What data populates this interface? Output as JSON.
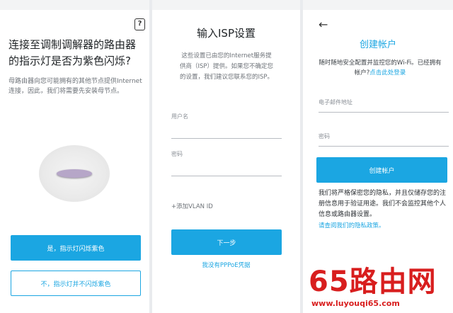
{
  "colors": {
    "accent": "#1ba6e2",
    "background": "#ffffff",
    "watermark": "#d81e1e"
  },
  "screen1": {
    "help_icon": "?",
    "title": "连接至调制调解器的路由器的指示灯是否为紫色闪烁?",
    "description": "母路由器向您可能拥有的其他节点提供Internet连接，因此，我们将需要先安装母节点。",
    "yes_button": "是，指示灯闪烁紫色",
    "no_button": "不，指示灯并不闪烁紫色"
  },
  "screen2": {
    "title": "输入ISP设置",
    "description": "这些设置已由您的Internet服务提供商（ISP）提供。如果您不确定您的设置，我们建议您联系您的ISP。",
    "username_label": "用户名",
    "password_label": "密码",
    "vlan_link": "+添加VLAN ID",
    "next_button": "下一步",
    "no_pppoe_link": "我没有PPPoE凭据"
  },
  "screen3": {
    "back_icon": "←",
    "title": "创建帐户",
    "description": "随时随地安全配置并监控您的Wi-Fi。已经拥有帐户?",
    "login_link": "点击此处登录",
    "email_label": "电子邮件地址",
    "password_label": "密码",
    "create_button": "创建帐户",
    "privacy_text": "我们将严格保密您的隐私，并且仅储存您的注册信息用于验证用途。我们不会监控其他个人信息或路由器设置。",
    "privacy_link": "请查阅我们的隐私政策。"
  },
  "watermark": {
    "main_text": "65路由网",
    "url_text": "www.luyouqi65.com"
  }
}
